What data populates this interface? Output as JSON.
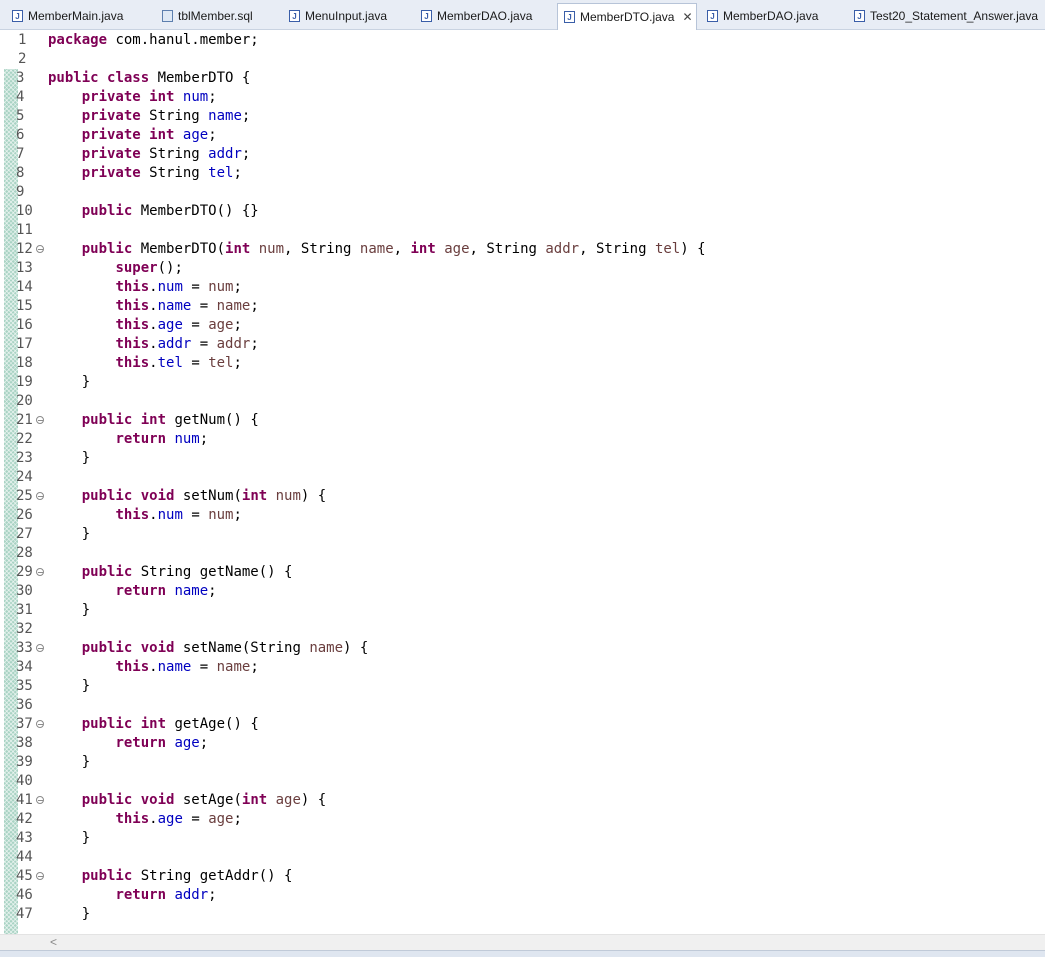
{
  "tabs": [
    {
      "label": "MemberMain.java",
      "icon": "java-file-icon",
      "active": false
    },
    {
      "label": "tblMember.sql",
      "icon": "sql-file-icon",
      "active": false
    },
    {
      "label": "MenuInput.java",
      "icon": "java-file-icon",
      "active": false
    },
    {
      "label": "MemberDAO.java",
      "icon": "java-file-icon",
      "active": false
    },
    {
      "label": "MemberDTO.java",
      "icon": "java-file-icon",
      "active": true,
      "close": "✕"
    },
    {
      "label": "MemberDAO.java",
      "icon": "java-file-icon",
      "active": false
    },
    {
      "label": "Test20_Statement_Answer.java",
      "icon": "java-file-icon",
      "active": false
    }
  ],
  "editor": {
    "colors": {
      "keyword": "#7f0055",
      "field": "#0000c0",
      "parameter": "#6a3e3e",
      "text": "#000000"
    },
    "lines": [
      {
        "n": "1",
        "changed": false,
        "fold": false,
        "tokens": [
          [
            "kw",
            "package"
          ],
          [
            "t",
            " com.hanul.member;"
          ]
        ]
      },
      {
        "n": "2",
        "changed": false,
        "fold": false,
        "tokens": []
      },
      {
        "n": "3",
        "changed": true,
        "fold": false,
        "tokens": [
          [
            "kw",
            "public"
          ],
          [
            "t",
            " "
          ],
          [
            "kw",
            "class"
          ],
          [
            "t",
            " MemberDTO {"
          ]
        ]
      },
      {
        "n": "4",
        "changed": true,
        "fold": false,
        "tokens": [
          [
            "t",
            "    "
          ],
          [
            "kw",
            "private"
          ],
          [
            "t",
            " "
          ],
          [
            "kw",
            "int"
          ],
          [
            "t",
            " "
          ],
          [
            "fld",
            "num"
          ],
          [
            "t",
            ";"
          ]
        ]
      },
      {
        "n": "5",
        "changed": true,
        "fold": false,
        "tokens": [
          [
            "t",
            "    "
          ],
          [
            "kw",
            "private"
          ],
          [
            "t",
            " String "
          ],
          [
            "fld",
            "name"
          ],
          [
            "t",
            ";"
          ]
        ]
      },
      {
        "n": "6",
        "changed": true,
        "fold": false,
        "tokens": [
          [
            "t",
            "    "
          ],
          [
            "kw",
            "private"
          ],
          [
            "t",
            " "
          ],
          [
            "kw",
            "int"
          ],
          [
            "t",
            " "
          ],
          [
            "fld",
            "age"
          ],
          [
            "t",
            ";"
          ]
        ]
      },
      {
        "n": "7",
        "changed": true,
        "fold": false,
        "tokens": [
          [
            "t",
            "    "
          ],
          [
            "kw",
            "private"
          ],
          [
            "t",
            " String "
          ],
          [
            "fld",
            "addr"
          ],
          [
            "t",
            ";"
          ]
        ]
      },
      {
        "n": "8",
        "changed": true,
        "fold": false,
        "tokens": [
          [
            "t",
            "    "
          ],
          [
            "kw",
            "private"
          ],
          [
            "t",
            " String "
          ],
          [
            "fld",
            "tel"
          ],
          [
            "t",
            ";"
          ]
        ]
      },
      {
        "n": "9",
        "changed": true,
        "fold": false,
        "tokens": []
      },
      {
        "n": "10",
        "changed": true,
        "fold": false,
        "tokens": [
          [
            "t",
            "    "
          ],
          [
            "kw",
            "public"
          ],
          [
            "t",
            " MemberDTO() {}"
          ]
        ]
      },
      {
        "n": "11",
        "changed": true,
        "fold": false,
        "tokens": []
      },
      {
        "n": "12",
        "changed": true,
        "fold": true,
        "tokens": [
          [
            "t",
            "    "
          ],
          [
            "kw",
            "public"
          ],
          [
            "t",
            " MemberDTO("
          ],
          [
            "kw",
            "int"
          ],
          [
            "t",
            " "
          ],
          [
            "prm",
            "num"
          ],
          [
            "t",
            ", String "
          ],
          [
            "prm",
            "name"
          ],
          [
            "t",
            ", "
          ],
          [
            "kw",
            "int"
          ],
          [
            "t",
            " "
          ],
          [
            "prm",
            "age"
          ],
          [
            "t",
            ", String "
          ],
          [
            "prm",
            "addr"
          ],
          [
            "t",
            ", String "
          ],
          [
            "prm",
            "tel"
          ],
          [
            "t",
            ") {"
          ]
        ]
      },
      {
        "n": "13",
        "changed": true,
        "fold": false,
        "tokens": [
          [
            "t",
            "        "
          ],
          [
            "kw",
            "super"
          ],
          [
            "t",
            "();"
          ]
        ]
      },
      {
        "n": "14",
        "changed": true,
        "fold": false,
        "tokens": [
          [
            "t",
            "        "
          ],
          [
            "kw",
            "this"
          ],
          [
            "t",
            "."
          ],
          [
            "fld",
            "num"
          ],
          [
            "t",
            " = "
          ],
          [
            "prm",
            "num"
          ],
          [
            "t",
            ";"
          ]
        ]
      },
      {
        "n": "15",
        "changed": true,
        "fold": false,
        "tokens": [
          [
            "t",
            "        "
          ],
          [
            "kw",
            "this"
          ],
          [
            "t",
            "."
          ],
          [
            "fld",
            "name"
          ],
          [
            "t",
            " = "
          ],
          [
            "prm",
            "name"
          ],
          [
            "t",
            ";"
          ]
        ]
      },
      {
        "n": "16",
        "changed": true,
        "fold": false,
        "tokens": [
          [
            "t",
            "        "
          ],
          [
            "kw",
            "this"
          ],
          [
            "t",
            "."
          ],
          [
            "fld",
            "age"
          ],
          [
            "t",
            " = "
          ],
          [
            "prm",
            "age"
          ],
          [
            "t",
            ";"
          ]
        ]
      },
      {
        "n": "17",
        "changed": true,
        "fold": false,
        "tokens": [
          [
            "t",
            "        "
          ],
          [
            "kw",
            "this"
          ],
          [
            "t",
            "."
          ],
          [
            "fld",
            "addr"
          ],
          [
            "t",
            " = "
          ],
          [
            "prm",
            "addr"
          ],
          [
            "t",
            ";"
          ]
        ]
      },
      {
        "n": "18",
        "changed": true,
        "fold": false,
        "tokens": [
          [
            "t",
            "        "
          ],
          [
            "kw",
            "this"
          ],
          [
            "t",
            "."
          ],
          [
            "fld",
            "tel"
          ],
          [
            "t",
            " = "
          ],
          [
            "prm",
            "tel"
          ],
          [
            "t",
            ";"
          ]
        ]
      },
      {
        "n": "19",
        "changed": true,
        "fold": false,
        "tokens": [
          [
            "t",
            "    }"
          ]
        ]
      },
      {
        "n": "20",
        "changed": true,
        "fold": false,
        "tokens": []
      },
      {
        "n": "21",
        "changed": true,
        "fold": true,
        "tokens": [
          [
            "t",
            "    "
          ],
          [
            "kw",
            "public"
          ],
          [
            "t",
            " "
          ],
          [
            "kw",
            "int"
          ],
          [
            "t",
            " getNum() {"
          ]
        ]
      },
      {
        "n": "22",
        "changed": true,
        "fold": false,
        "tokens": [
          [
            "t",
            "        "
          ],
          [
            "kw",
            "return"
          ],
          [
            "t",
            " "
          ],
          [
            "fld",
            "num"
          ],
          [
            "t",
            ";"
          ]
        ]
      },
      {
        "n": "23",
        "changed": true,
        "fold": false,
        "tokens": [
          [
            "t",
            "    }"
          ]
        ]
      },
      {
        "n": "24",
        "changed": true,
        "fold": false,
        "tokens": []
      },
      {
        "n": "25",
        "changed": true,
        "fold": true,
        "tokens": [
          [
            "t",
            "    "
          ],
          [
            "kw",
            "public"
          ],
          [
            "t",
            " "
          ],
          [
            "kw",
            "void"
          ],
          [
            "t",
            " setNum("
          ],
          [
            "kw",
            "int"
          ],
          [
            "t",
            " "
          ],
          [
            "prm",
            "num"
          ],
          [
            "t",
            ") {"
          ]
        ]
      },
      {
        "n": "26",
        "changed": true,
        "fold": false,
        "tokens": [
          [
            "t",
            "        "
          ],
          [
            "kw",
            "this"
          ],
          [
            "t",
            "."
          ],
          [
            "fld",
            "num"
          ],
          [
            "t",
            " = "
          ],
          [
            "prm",
            "num"
          ],
          [
            "t",
            ";"
          ]
        ]
      },
      {
        "n": "27",
        "changed": true,
        "fold": false,
        "tokens": [
          [
            "t",
            "    }"
          ]
        ]
      },
      {
        "n": "28",
        "changed": true,
        "fold": false,
        "tokens": []
      },
      {
        "n": "29",
        "changed": true,
        "fold": true,
        "tokens": [
          [
            "t",
            "    "
          ],
          [
            "kw",
            "public"
          ],
          [
            "t",
            " String getName() {"
          ]
        ]
      },
      {
        "n": "30",
        "changed": true,
        "fold": false,
        "tokens": [
          [
            "t",
            "        "
          ],
          [
            "kw",
            "return"
          ],
          [
            "t",
            " "
          ],
          [
            "fld",
            "name"
          ],
          [
            "t",
            ";"
          ]
        ]
      },
      {
        "n": "31",
        "changed": true,
        "fold": false,
        "tokens": [
          [
            "t",
            "    }"
          ]
        ]
      },
      {
        "n": "32",
        "changed": true,
        "fold": false,
        "tokens": []
      },
      {
        "n": "33",
        "changed": true,
        "fold": true,
        "tokens": [
          [
            "t",
            "    "
          ],
          [
            "kw",
            "public"
          ],
          [
            "t",
            " "
          ],
          [
            "kw",
            "void"
          ],
          [
            "t",
            " setName(String "
          ],
          [
            "prm",
            "name"
          ],
          [
            "t",
            ") {"
          ]
        ]
      },
      {
        "n": "34",
        "changed": true,
        "fold": false,
        "tokens": [
          [
            "t",
            "        "
          ],
          [
            "kw",
            "this"
          ],
          [
            "t",
            "."
          ],
          [
            "fld",
            "name"
          ],
          [
            "t",
            " = "
          ],
          [
            "prm",
            "name"
          ],
          [
            "t",
            ";"
          ]
        ]
      },
      {
        "n": "35",
        "changed": true,
        "fold": false,
        "tokens": [
          [
            "t",
            "    }"
          ]
        ]
      },
      {
        "n": "36",
        "changed": true,
        "fold": false,
        "tokens": []
      },
      {
        "n": "37",
        "changed": true,
        "fold": true,
        "tokens": [
          [
            "t",
            "    "
          ],
          [
            "kw",
            "public"
          ],
          [
            "t",
            " "
          ],
          [
            "kw",
            "int"
          ],
          [
            "t",
            " getAge() {"
          ]
        ]
      },
      {
        "n": "38",
        "changed": true,
        "fold": false,
        "tokens": [
          [
            "t",
            "        "
          ],
          [
            "kw",
            "return"
          ],
          [
            "t",
            " "
          ],
          [
            "fld",
            "age"
          ],
          [
            "t",
            ";"
          ]
        ]
      },
      {
        "n": "39",
        "changed": true,
        "fold": false,
        "tokens": [
          [
            "t",
            "    }"
          ]
        ]
      },
      {
        "n": "40",
        "changed": true,
        "fold": false,
        "tokens": []
      },
      {
        "n": "41",
        "changed": true,
        "fold": true,
        "tokens": [
          [
            "t",
            "    "
          ],
          [
            "kw",
            "public"
          ],
          [
            "t",
            " "
          ],
          [
            "kw",
            "void"
          ],
          [
            "t",
            " setAge("
          ],
          [
            "kw",
            "int"
          ],
          [
            "t",
            " "
          ],
          [
            "prm",
            "age"
          ],
          [
            "t",
            ") {"
          ]
        ]
      },
      {
        "n": "42",
        "changed": true,
        "fold": false,
        "tokens": [
          [
            "t",
            "        "
          ],
          [
            "kw",
            "this"
          ],
          [
            "t",
            "."
          ],
          [
            "fld",
            "age"
          ],
          [
            "t",
            " = "
          ],
          [
            "prm",
            "age"
          ],
          [
            "t",
            ";"
          ]
        ]
      },
      {
        "n": "43",
        "changed": true,
        "fold": false,
        "tokens": [
          [
            "t",
            "    }"
          ]
        ]
      },
      {
        "n": "44",
        "changed": true,
        "fold": false,
        "tokens": []
      },
      {
        "n": "45",
        "changed": true,
        "fold": true,
        "tokens": [
          [
            "t",
            "    "
          ],
          [
            "kw",
            "public"
          ],
          [
            "t",
            " String getAddr() {"
          ]
        ]
      },
      {
        "n": "46",
        "changed": true,
        "fold": false,
        "tokens": [
          [
            "t",
            "        "
          ],
          [
            "kw",
            "return"
          ],
          [
            "t",
            " "
          ],
          [
            "fld",
            "addr"
          ],
          [
            "t",
            ";"
          ]
        ]
      },
      {
        "n": "47",
        "changed": true,
        "fold": false,
        "tokens": [
          [
            "t",
            "    }"
          ]
        ]
      }
    ]
  },
  "hscroll": {
    "left_arrow": "<"
  }
}
